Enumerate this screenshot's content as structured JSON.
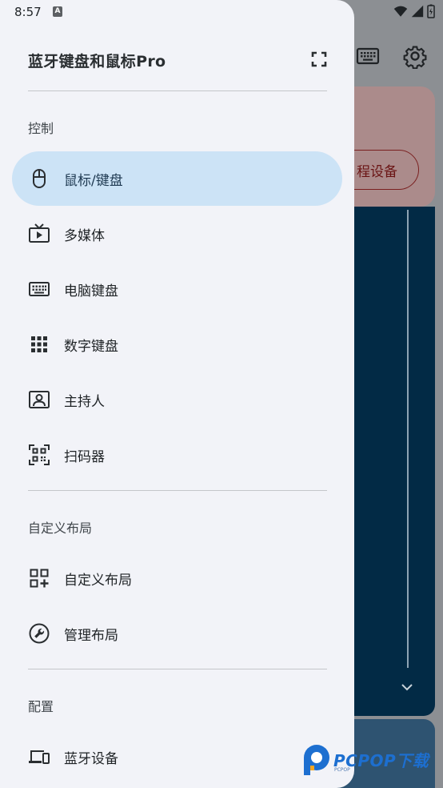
{
  "status_bar": {
    "time": "8:57",
    "notif_icon": "A"
  },
  "background": {
    "pill_label": "程设备"
  },
  "drawer": {
    "title": "蓝牙键盘和鼠标Pro",
    "sections": [
      {
        "label": "控制"
      },
      {
        "label": "自定义布局"
      },
      {
        "label": "配置"
      }
    ],
    "control_items": [
      {
        "label": "鼠标/键盘",
        "icon": "mouse-icon",
        "selected": true
      },
      {
        "label": "多媒体",
        "icon": "tv-play-icon"
      },
      {
        "label": "电脑键盘",
        "icon": "keyboard-icon"
      },
      {
        "label": "数字键盘",
        "icon": "dialpad-icon"
      },
      {
        "label": "主持人",
        "icon": "presenter-icon"
      },
      {
        "label": "扫码器",
        "icon": "qr-scanner-icon"
      }
    ],
    "custom_items": [
      {
        "label": "自定义布局",
        "icon": "widgets-add-icon"
      },
      {
        "label": "管理布局",
        "icon": "wrench-icon"
      }
    ],
    "config_items": [
      {
        "label": "蓝牙设备",
        "icon": "devices-icon"
      }
    ]
  },
  "watermark": {
    "brand": "PCPOP下载",
    "sub": "PCPOP"
  }
}
